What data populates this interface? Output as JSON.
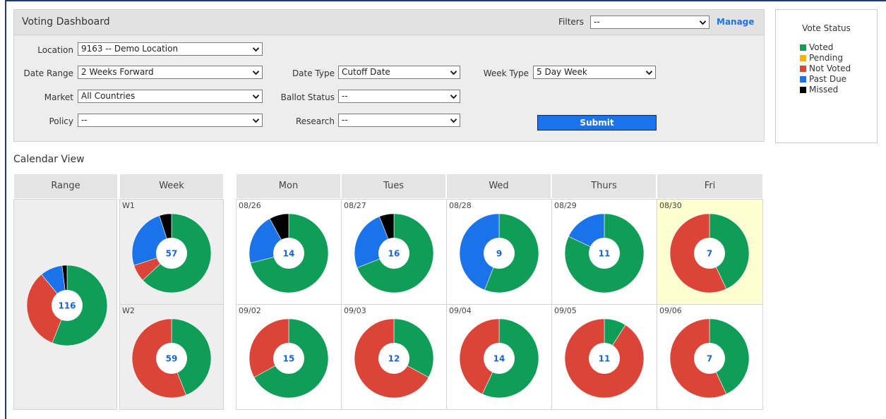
{
  "panel": {
    "title": "Voting Dashboard",
    "filters_label": "Filters",
    "filters_value": "--",
    "manage_label": "Manage"
  },
  "form": {
    "location_label": "Location",
    "location_value": "9163 -- Demo Location",
    "date_range_label": "Date Range",
    "date_range_value": "2 Weeks Forward",
    "date_type_label": "Date Type",
    "date_type_value": "Cutoff Date",
    "week_type_label": "Week Type",
    "week_type_value": "5 Day Week",
    "market_label": "Market",
    "market_value": "All Countries",
    "ballot_status_label": "Ballot Status",
    "ballot_status_value": "--",
    "policy_label": "Policy",
    "policy_value": "--",
    "research_label": "Research",
    "research_value": "--",
    "submit_label": "Submit"
  },
  "legend": {
    "title": "Vote Status",
    "items": [
      {
        "label": "Voted",
        "color": "#0f9d58"
      },
      {
        "label": "Pending",
        "color": "#f4b400"
      },
      {
        "label": "Not Voted",
        "color": "#db4437"
      },
      {
        "label": "Past Due",
        "color": "#1a73e8"
      },
      {
        "label": "Missed",
        "color": "#000000"
      }
    ]
  },
  "calendar": {
    "title": "Calendar View",
    "headers": [
      "Range",
      "Week",
      "Mon",
      "Tues",
      "Wed",
      "Thurs",
      "Fri"
    ],
    "range": {
      "count": "116",
      "voted": 0.56,
      "not_voted": 0.33,
      "past_due": 0.09,
      "missed": 0.02
    },
    "weeks": [
      {
        "label": "W1",
        "count": "57",
        "voted": 0.63,
        "not_voted": 0.07,
        "past_due": 0.25,
        "missed": 0.05
      },
      {
        "label": "W2",
        "count": "59",
        "voted": 0.44,
        "not_voted": 0.56,
        "past_due": 0,
        "missed": 0
      }
    ],
    "days": [
      {
        "date": "08/26",
        "count": "14",
        "voted": 0.71,
        "not_voted": 0,
        "past_due": 0.21,
        "missed": 0.08,
        "highlight": false
      },
      {
        "date": "08/27",
        "count": "16",
        "voted": 0.69,
        "not_voted": 0,
        "past_due": 0.25,
        "missed": 0.06,
        "highlight": false
      },
      {
        "date": "08/28",
        "count": "9",
        "voted": 0.56,
        "not_voted": 0,
        "past_due": 0.44,
        "missed": 0,
        "highlight": false
      },
      {
        "date": "08/29",
        "count": "11",
        "voted": 0.82,
        "not_voted": 0,
        "past_due": 0.18,
        "missed": 0,
        "highlight": false
      },
      {
        "date": "08/30",
        "count": "7",
        "voted": 0.43,
        "not_voted": 0.57,
        "past_due": 0,
        "missed": 0,
        "highlight": true
      },
      {
        "date": "09/02",
        "count": "15",
        "voted": 0.67,
        "not_voted": 0.33,
        "past_due": 0,
        "missed": 0,
        "highlight": false
      },
      {
        "date": "09/03",
        "count": "12",
        "voted": 0.33,
        "not_voted": 0.67,
        "past_due": 0,
        "missed": 0,
        "highlight": false
      },
      {
        "date": "09/04",
        "count": "14",
        "voted": 0.57,
        "not_voted": 0.43,
        "past_due": 0,
        "missed": 0,
        "highlight": false
      },
      {
        "date": "09/05",
        "count": "11",
        "voted": 0.09,
        "not_voted": 0.91,
        "past_due": 0,
        "missed": 0,
        "highlight": false
      },
      {
        "date": "09/06",
        "count": "7",
        "voted": 0.43,
        "not_voted": 0.57,
        "past_due": 0,
        "missed": 0,
        "highlight": false
      }
    ]
  },
  "colors": {
    "voted": "#0f9d58",
    "pending": "#f4b400",
    "not_voted": "#db4437",
    "past_due": "#1a73e8",
    "missed": "#000000",
    "count_text": "#1a66cc"
  }
}
